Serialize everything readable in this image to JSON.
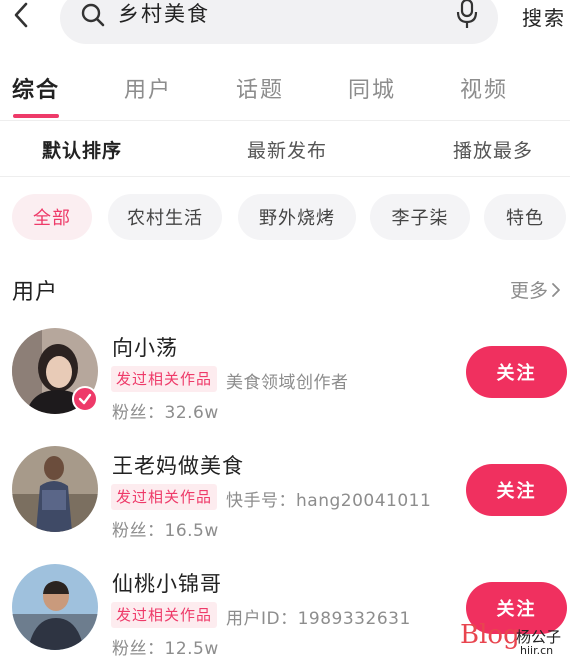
{
  "search": {
    "query": "乡村美食",
    "button_label": "搜索"
  },
  "tabs": [
    {
      "label": "综合",
      "active": true
    },
    {
      "label": "用户",
      "active": false
    },
    {
      "label": "话题",
      "active": false
    },
    {
      "label": "同城",
      "active": false
    },
    {
      "label": "视频",
      "active": false
    }
  ],
  "sort": [
    {
      "label": "默认排序",
      "active": true
    },
    {
      "label": "最新发布",
      "active": false
    },
    {
      "label": "播放最多",
      "active": false
    }
  ],
  "chips": [
    {
      "label": "全部",
      "active": true
    },
    {
      "label": "农村生活",
      "active": false
    },
    {
      "label": "野外烧烤",
      "active": false
    },
    {
      "label": "李子柒",
      "active": false
    },
    {
      "label": "特色",
      "active": false
    }
  ],
  "users_section": {
    "title": "用户",
    "more_label": "更多"
  },
  "users": [
    {
      "name": "向小荡",
      "tag": "发过相关作品",
      "desc": "美食领域创作者",
      "fans": "粉丝：32.6w",
      "follow_label": "关注",
      "verified": true
    },
    {
      "name": "王老妈做美食",
      "tag": "发过相关作品",
      "desc": "快手号：hang20041011",
      "fans": "粉丝：16.5w",
      "follow_label": "关注",
      "verified": false
    },
    {
      "name": "仙桃小锦哥",
      "tag": "发过相关作品",
      "desc": "用户ID：1989332631",
      "fans": "粉丝：12.5w",
      "follow_label": "关注",
      "verified": false
    }
  ],
  "watermark": {
    "blog": "Blog",
    "name": "杨公子",
    "site": "hiir.cn"
  },
  "colors": {
    "accent": "#ee3a69",
    "follow_button": "#f0305f",
    "chip_bg": "#f4f4f6",
    "muted_text": "#8d8d8d"
  },
  "icons": {
    "back": "chevron-left-icon",
    "search": "search-icon",
    "mic": "microphone-icon",
    "more": "chevron-right-icon",
    "verified": "check-badge-icon"
  }
}
